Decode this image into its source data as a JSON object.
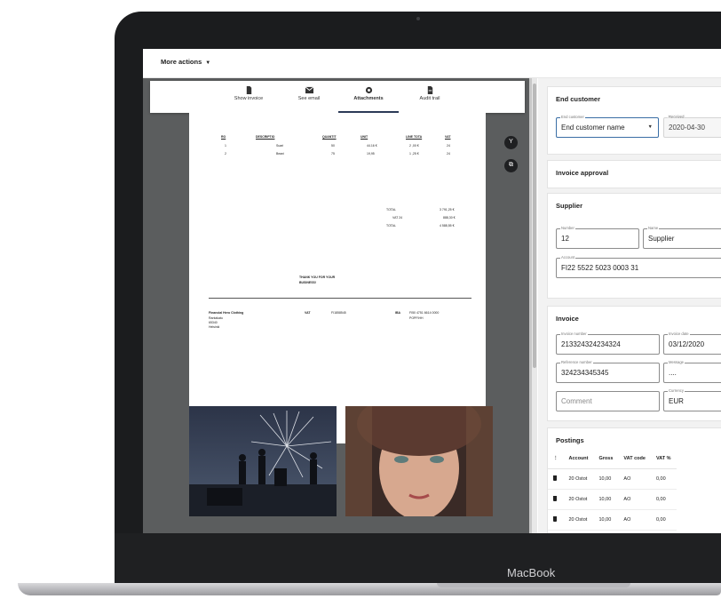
{
  "device": {
    "brand": "MacBook"
  },
  "toolbar": {
    "more_actions": "More actions"
  },
  "tabs": [
    {
      "label": "Show invoice",
      "icon": "document-icon"
    },
    {
      "label": "See email",
      "icon": "email-icon"
    },
    {
      "label": "Attachments",
      "icon": "attachment-icon",
      "active": true
    },
    {
      "label": "Audit trail",
      "icon": "audit-icon"
    }
  ],
  "invoice_doc": {
    "columns": [
      "RO",
      "DESCRIPTIO",
      "QUANTIT",
      "UNIT",
      "LINE TOTA",
      "VAT"
    ],
    "rows": [
      [
        "1",
        "Suari",
        "50",
        "44.16 €",
        "2 ,00 €",
        "24"
      ],
      [
        "2",
        "Beani",
        "75",
        "19,95",
        "1 ,25 €",
        "24"
      ]
    ],
    "totals": [
      {
        "label": "TOTAL",
        "value": "3 791,25 €"
      },
      {
        "label": "VAT 24",
        "value": "888,30 €"
      },
      {
        "label": "TOTAL",
        "value": "4 588,55 €"
      }
    ],
    "thanks_line1": "THANK YOU FOR YOUR",
    "thanks_line2": "BUSINESS!",
    "footer_company": "Financial Hero Clothing",
    "footer_address_1": "Rantakatu",
    "footer_address_2": "65340",
    "footer_address_3": "Helsinki",
    "footer_vat_label": "VAT",
    "footer_vat_value": "FI1858545",
    "footer_iban_label": "IBA",
    "footer_iban_value": "FI50 4751 6614 0000",
    "footer_bic_value": "POPFIHH"
  },
  "end_customer": {
    "title": "End customer",
    "end_customer_legend": "End customer",
    "end_customer_value": "End customer name",
    "received_legend": "Received",
    "received_value": "2020-04-30"
  },
  "invoice_approval": {
    "title": "Invoice approval"
  },
  "supplier": {
    "title": "Supplier",
    "number_legend": "Number",
    "number_value": "12",
    "name_legend": "Name",
    "name_value": "Supplier",
    "account_legend": "Account",
    "account_value": "FI22 5522 5023 0003 31"
  },
  "invoice": {
    "title": "Invoice",
    "invoice_number_legend": "Invoice number",
    "invoice_number_value": "213324324234324",
    "invoice_date_legend": "Invoice date",
    "invoice_date_value": "03/12/2020",
    "reference_legend": "Reference number",
    "reference_value": "324234345345",
    "message_legend": "Message",
    "message_value": "....",
    "comment_placeholder": "Comment",
    "currency_legend": "Currency",
    "currency_value": "EUR"
  },
  "postings": {
    "title": "Postings",
    "columns": [
      "Account",
      "Gross",
      "VAT code",
      "VAT %"
    ],
    "rows": [
      {
        "account": "20 Ostot",
        "gross": "10,00",
        "vat_code": "AO",
        "vat": "0,00"
      },
      {
        "account": "20 Ostot",
        "gross": "10,00",
        "vat_code": "AO",
        "vat": "0,00"
      },
      {
        "account": "20 Ostot",
        "gross": "10,00",
        "vat_code": "AO",
        "vat": "0,00"
      }
    ]
  },
  "colors": {
    "frame": "#1b1c1e",
    "viewer_bg": "#5b5d5e",
    "panel_bg": "#f2f2f2",
    "active_tab": "#2b3a57",
    "field_focus": "#3a6ea5"
  }
}
